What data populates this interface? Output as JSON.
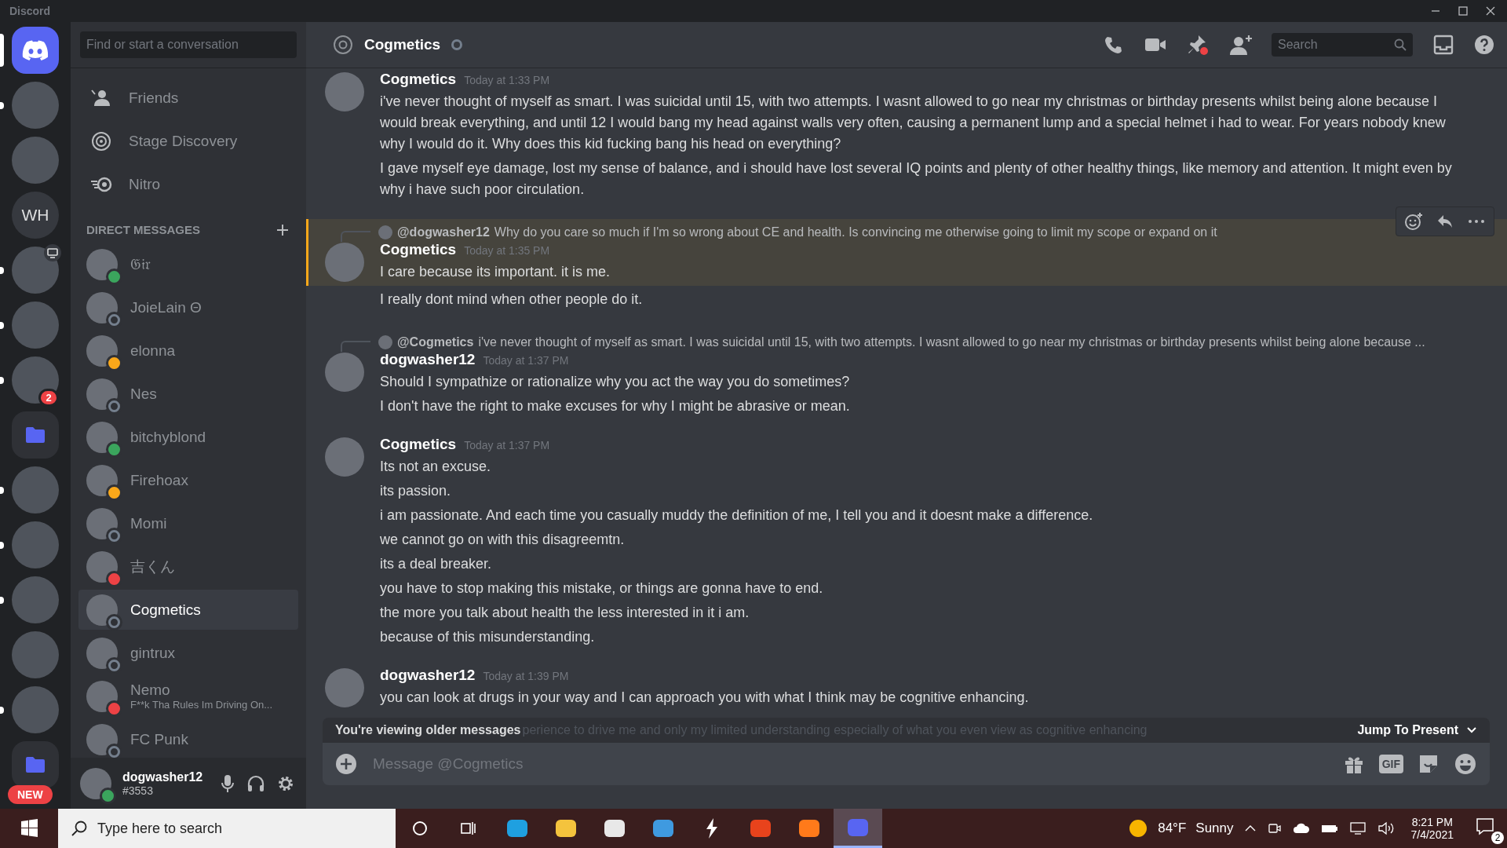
{
  "app_title": "Discord",
  "servers": [
    {
      "kind": "home",
      "selected": true,
      "unread": false
    },
    {
      "kind": "image",
      "selected": false,
      "unread": true
    },
    {
      "kind": "image",
      "selected": false,
      "unread": false
    },
    {
      "kind": "initials",
      "label": "WH",
      "selected": false,
      "unread": false
    },
    {
      "kind": "image",
      "selected": false,
      "unread": true,
      "live": true
    },
    {
      "kind": "image",
      "selected": false,
      "unread": true
    },
    {
      "kind": "image",
      "selected": false,
      "unread": true,
      "badge": "2"
    },
    {
      "kind": "folder",
      "selected": false,
      "unread": false
    },
    {
      "kind": "image",
      "selected": false,
      "unread": true
    },
    {
      "kind": "image",
      "selected": false,
      "unread": true
    },
    {
      "kind": "image",
      "selected": false,
      "unread": true
    },
    {
      "kind": "image",
      "selected": false,
      "unread": false
    },
    {
      "kind": "image",
      "selected": false,
      "unread": true
    },
    {
      "kind": "folder",
      "selected": false,
      "unread": false
    }
  ],
  "new_badge": "NEW",
  "dm_search": {
    "placeholder": "Find or start a conversation"
  },
  "nav": [
    {
      "kind": "friends",
      "label": "Friends"
    },
    {
      "kind": "stage",
      "label": "Stage Discovery"
    },
    {
      "kind": "nitro",
      "label": "Nitro"
    }
  ],
  "dm_header": "DIRECT MESSAGES",
  "dms": [
    {
      "name": "𝔊𝔦𝔯",
      "color": "#3ba55d",
      "selected": false
    },
    {
      "name": "JoieLain Θ",
      "color": "#747f8d",
      "selected": false
    },
    {
      "name": "elonna",
      "color": "#faa81a",
      "selected": false
    },
    {
      "name": "Nes",
      "color": "#747f8d",
      "selected": false
    },
    {
      "name": "bitchyblond",
      "color": "#3ba55d",
      "selected": false
    },
    {
      "name": "Firehoax",
      "color": "#faa81a",
      "selected": false
    },
    {
      "name": "Momi",
      "color": "#747f8d",
      "selected": false
    },
    {
      "name": "吉くん",
      "color": "#ed4245",
      "selected": false
    },
    {
      "name": "Cogmetics",
      "color": "#747f8d",
      "selected": true
    },
    {
      "name": "gintrux",
      "color": "#747f8d",
      "selected": false
    },
    {
      "name": "Nemo",
      "color": "#ed4245",
      "selected": false,
      "subtitle": "F**k Tha Rules Im Driving On..."
    },
    {
      "name": "FC Punk",
      "color": "#747f8d",
      "selected": false
    }
  ],
  "user": {
    "name": "dogwasher12",
    "tag": "#3553",
    "color": "#3ba55d"
  },
  "channel": {
    "name": "Cogmetics",
    "color": "#747f8d",
    "search_placeholder": "Search"
  },
  "messages": [
    {
      "kind": "full",
      "author": "Cogmetics",
      "time": "Today at 1:33 PM",
      "highlighted": false,
      "hovered": false,
      "lines": [
        "i've never thought of myself as smart. I was suicidal until 15, with two attempts. I wasnt allowed to go near my christmas or birthday presents whilst being alone because I would break everything, and until 12 I would bang my head against walls very often, causing a permanent lump and a special helmet i had to wear. For years nobody knew why I would do it. Why does this kid fucking bang his head on everything?",
        "I gave myself eye damage, lost my sense of balance, and i should have lost several IQ points and plenty of other healthy things, like memory and attention. It might even by why i have such poor circulation."
      ]
    },
    {
      "kind": "full",
      "reply": {
        "author": "@dogwasher12",
        "text": "Why do you care so much if I'm so wrong about CE and health. Is convincing me otherwise going to limit my scope or expand on it"
      },
      "author": "Cogmetics",
      "time": "Today at 1:35 PM",
      "highlighted": true,
      "hovered": true,
      "lines": [
        "I care because its important. it is me."
      ]
    },
    {
      "kind": "continuation",
      "highlighted": false,
      "hovered": false,
      "lines": [
        "I really dont mind when other people do it."
      ]
    },
    {
      "kind": "full",
      "reply": {
        "author": "@Cogmetics",
        "text": "i've never thought of myself as smart. I was suicidal until 15, with two attempts. I wasnt allowed to go near my christmas or birthday presents whilst being alone because ..."
      },
      "author": "dogwasher12",
      "time": "Today at 1:37 PM",
      "highlighted": false,
      "hovered": false,
      "lines": [
        "Should I sympathize or rationalize why you act the way you do sometimes?",
        "I don't have the right to make excuses for why I might be abrasive or mean."
      ]
    },
    {
      "kind": "full",
      "author": "Cogmetics",
      "time": "Today at 1:37 PM",
      "highlighted": false,
      "hovered": false,
      "lines": [
        "Its not an excuse.",
        "its passion.",
        "i am passionate. And each time you casually muddy the definition of me, I tell you and it doesnt make a difference.",
        "we cannot go on with this disagreemtn.",
        "its a deal breaker.",
        "you have to stop making this mistake, or things are gonna have to end.",
        "the more you talk about health the less interested in it i am.",
        "because of this misunderstanding."
      ]
    },
    {
      "kind": "full",
      "author": "dogwasher12",
      "time": "Today at 1:39 PM",
      "highlighted": false,
      "hovered": false,
      "lines": [
        "you can look at drugs in your way and I can approach you with what I think may be cognitive enhancing."
      ]
    }
  ],
  "older_bar": {
    "label": "You're viewing older messages",
    "hidden_text": "perience to drive me and only my limited understanding especially of what you even view as cognitive enhancing",
    "jump": "Jump To Present"
  },
  "composer": {
    "placeholder": "Message @Cogmetics",
    "gif_label": "GIF"
  },
  "taskbar": {
    "search_placeholder": "Type here to search",
    "apps": [
      {
        "kind": "cortana",
        "active": false
      },
      {
        "kind": "taskview",
        "active": false
      },
      {
        "kind": "edge",
        "active": false
      },
      {
        "kind": "explorer",
        "active": false
      },
      {
        "kind": "store",
        "active": false
      },
      {
        "kind": "mail",
        "active": false
      },
      {
        "kind": "bolt",
        "active": false
      },
      {
        "kind": "office",
        "active": false
      },
      {
        "kind": "firefox",
        "active": false
      },
      {
        "kind": "discord",
        "active": true
      }
    ],
    "temperature": "84°F",
    "weather": "Sunny",
    "time": "8:21 PM",
    "date": "7/4/2021",
    "notifications": "2"
  }
}
